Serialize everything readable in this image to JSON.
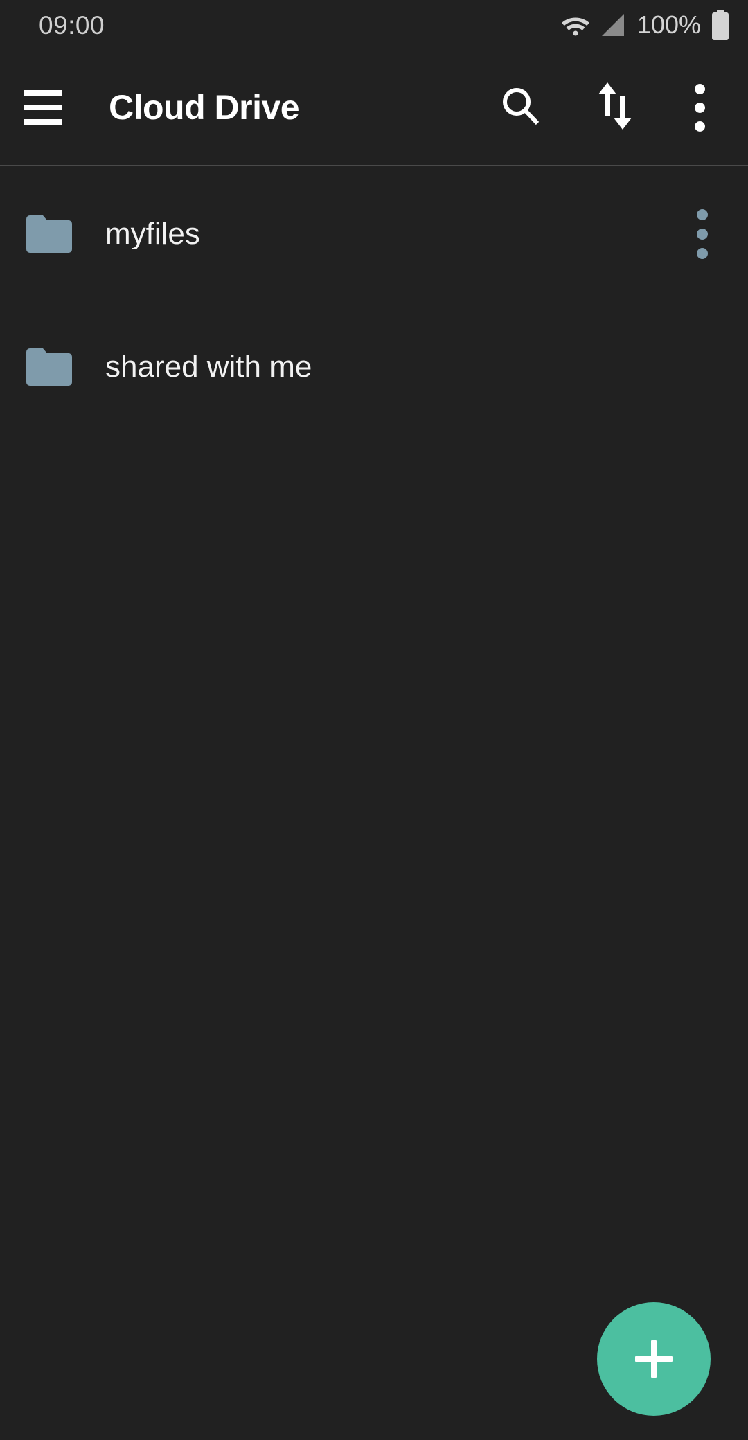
{
  "status_bar": {
    "clock": "09:00",
    "battery_percent": "100%",
    "wifi_icon": "wifi-icon",
    "signal_icon": "cellular-signal-icon",
    "battery_icon": "battery-full-icon"
  },
  "app_bar": {
    "menu_icon": "hamburger-menu-icon",
    "title": "Cloud Drive",
    "search_icon": "search-icon",
    "sort_icon": "sort-arrows-icon",
    "overflow_icon": "more-vertical-icon"
  },
  "file_list": {
    "items": [
      {
        "name": "myfiles",
        "icon": "folder-icon",
        "has_overflow": true
      },
      {
        "name": "shared with me",
        "icon": "folder-icon",
        "has_overflow": false
      }
    ]
  },
  "fab": {
    "label": "+",
    "icon": "plus-icon",
    "color": "#4cbfa0"
  },
  "colors": {
    "background": "#212121",
    "folder": "#7f9bab",
    "accent": "#4cbfa0",
    "divider": "#4a4a4a",
    "text_primary": "#f2f2f2",
    "status_text": "#cfcfcf"
  }
}
